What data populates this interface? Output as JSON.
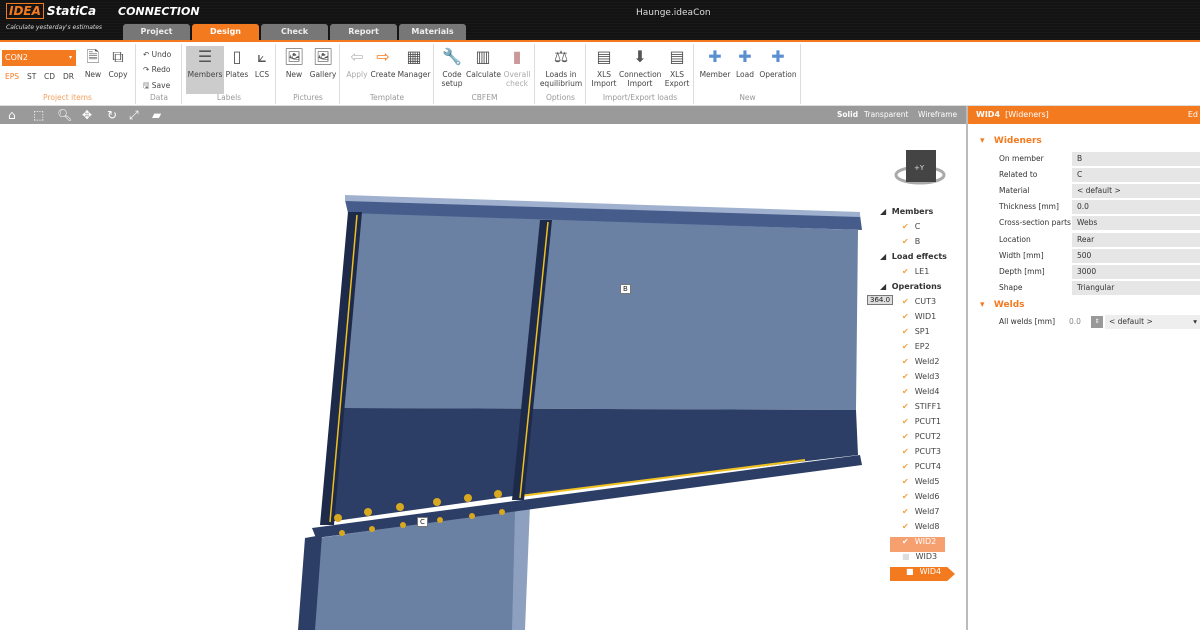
{
  "app": {
    "brand": "IDEA",
    "brand2": "StatiCa",
    "product": "CONNECTION",
    "slogan": "Calculate yesterday's estimates",
    "filename": "Haunge.ideaCon"
  },
  "tabs": [
    "Project",
    "Design",
    "Check",
    "Report",
    "Materials"
  ],
  "active_tab": "Design",
  "ribbon": {
    "project_items": {
      "selected": "CON2",
      "items": [
        "EPS",
        "ST",
        "CD",
        "DR"
      ],
      "new": "New",
      "copy": "Copy",
      "label": "Project items"
    },
    "data": {
      "undo": "Undo",
      "redo": "Redo",
      "save": "Save",
      "label": "Data"
    },
    "labels": {
      "members": "Members",
      "plates": "Plates",
      "lcs": "LCS",
      "label": "Labels"
    },
    "pictures": {
      "new": "New",
      "gallery": "Gallery",
      "label": "Pictures"
    },
    "template": {
      "apply": "Apply",
      "create": "Create",
      "manager": "Manager",
      "label": "Template"
    },
    "cbfem": {
      "code_setup": "Code setup",
      "calculate": "Calculate",
      "overall_check": "Overall check",
      "label": "CBFEM"
    },
    "options": {
      "loads": "Loads in equilibrium",
      "label": "Options"
    },
    "import_export": {
      "xls_import": "XLS Import",
      "connection_import": "Connection Import",
      "xls_export": "XLS Export",
      "label": "Import/Export loads"
    },
    "new": {
      "member": "Member",
      "load": "Load",
      "operation": "Operation",
      "label": "New"
    }
  },
  "view_modes": [
    "Solid",
    "Transparent",
    "Wireframe"
  ],
  "viewport": {
    "member_labels": [
      "B",
      "C"
    ],
    "dimension": "364.0",
    "cube_label": "+Y"
  },
  "tree": {
    "members": {
      "title": "Members",
      "items": [
        "C",
        "B"
      ]
    },
    "load_effects": {
      "title": "Load effects",
      "items": [
        "LE1"
      ]
    },
    "operations": {
      "title": "Operations",
      "items": [
        "CUT3",
        "WID1",
        "SP1",
        "EP2",
        "Weld2",
        "Weld3",
        "Weld4",
        "STIFF1",
        "PCUT1",
        "PCUT2",
        "PCUT3",
        "PCUT4",
        "Weld5",
        "Weld6",
        "Weld7",
        "Weld8"
      ],
      "hover": "WID2",
      "unchecked": "WID3",
      "selected": "WID4"
    }
  },
  "panel": {
    "title": "WID4",
    "subtitle": "[Wideners]",
    "edit": "Ed",
    "wideners_title": "Wideners",
    "rows": [
      [
        "On member",
        "B"
      ],
      [
        "Related to",
        "C"
      ],
      [
        "Material",
        "< default >"
      ],
      [
        "Thickness [mm]",
        "0.0"
      ],
      [
        "Cross-section parts",
        "Webs"
      ],
      [
        "Location",
        "Rear"
      ],
      [
        "Width [mm]",
        "500"
      ],
      [
        "Depth [mm]",
        "3000"
      ],
      [
        "Shape",
        "Triangular"
      ]
    ],
    "welds_title": "Welds",
    "welds_label": "All welds [mm]",
    "welds_value": "0.0",
    "welds_material": "< default >"
  },
  "colors": {
    "accent": "#f47a20",
    "steel_light": "#6a81a4",
    "steel_dark": "#2c3d66",
    "weld": "#f0c020"
  }
}
